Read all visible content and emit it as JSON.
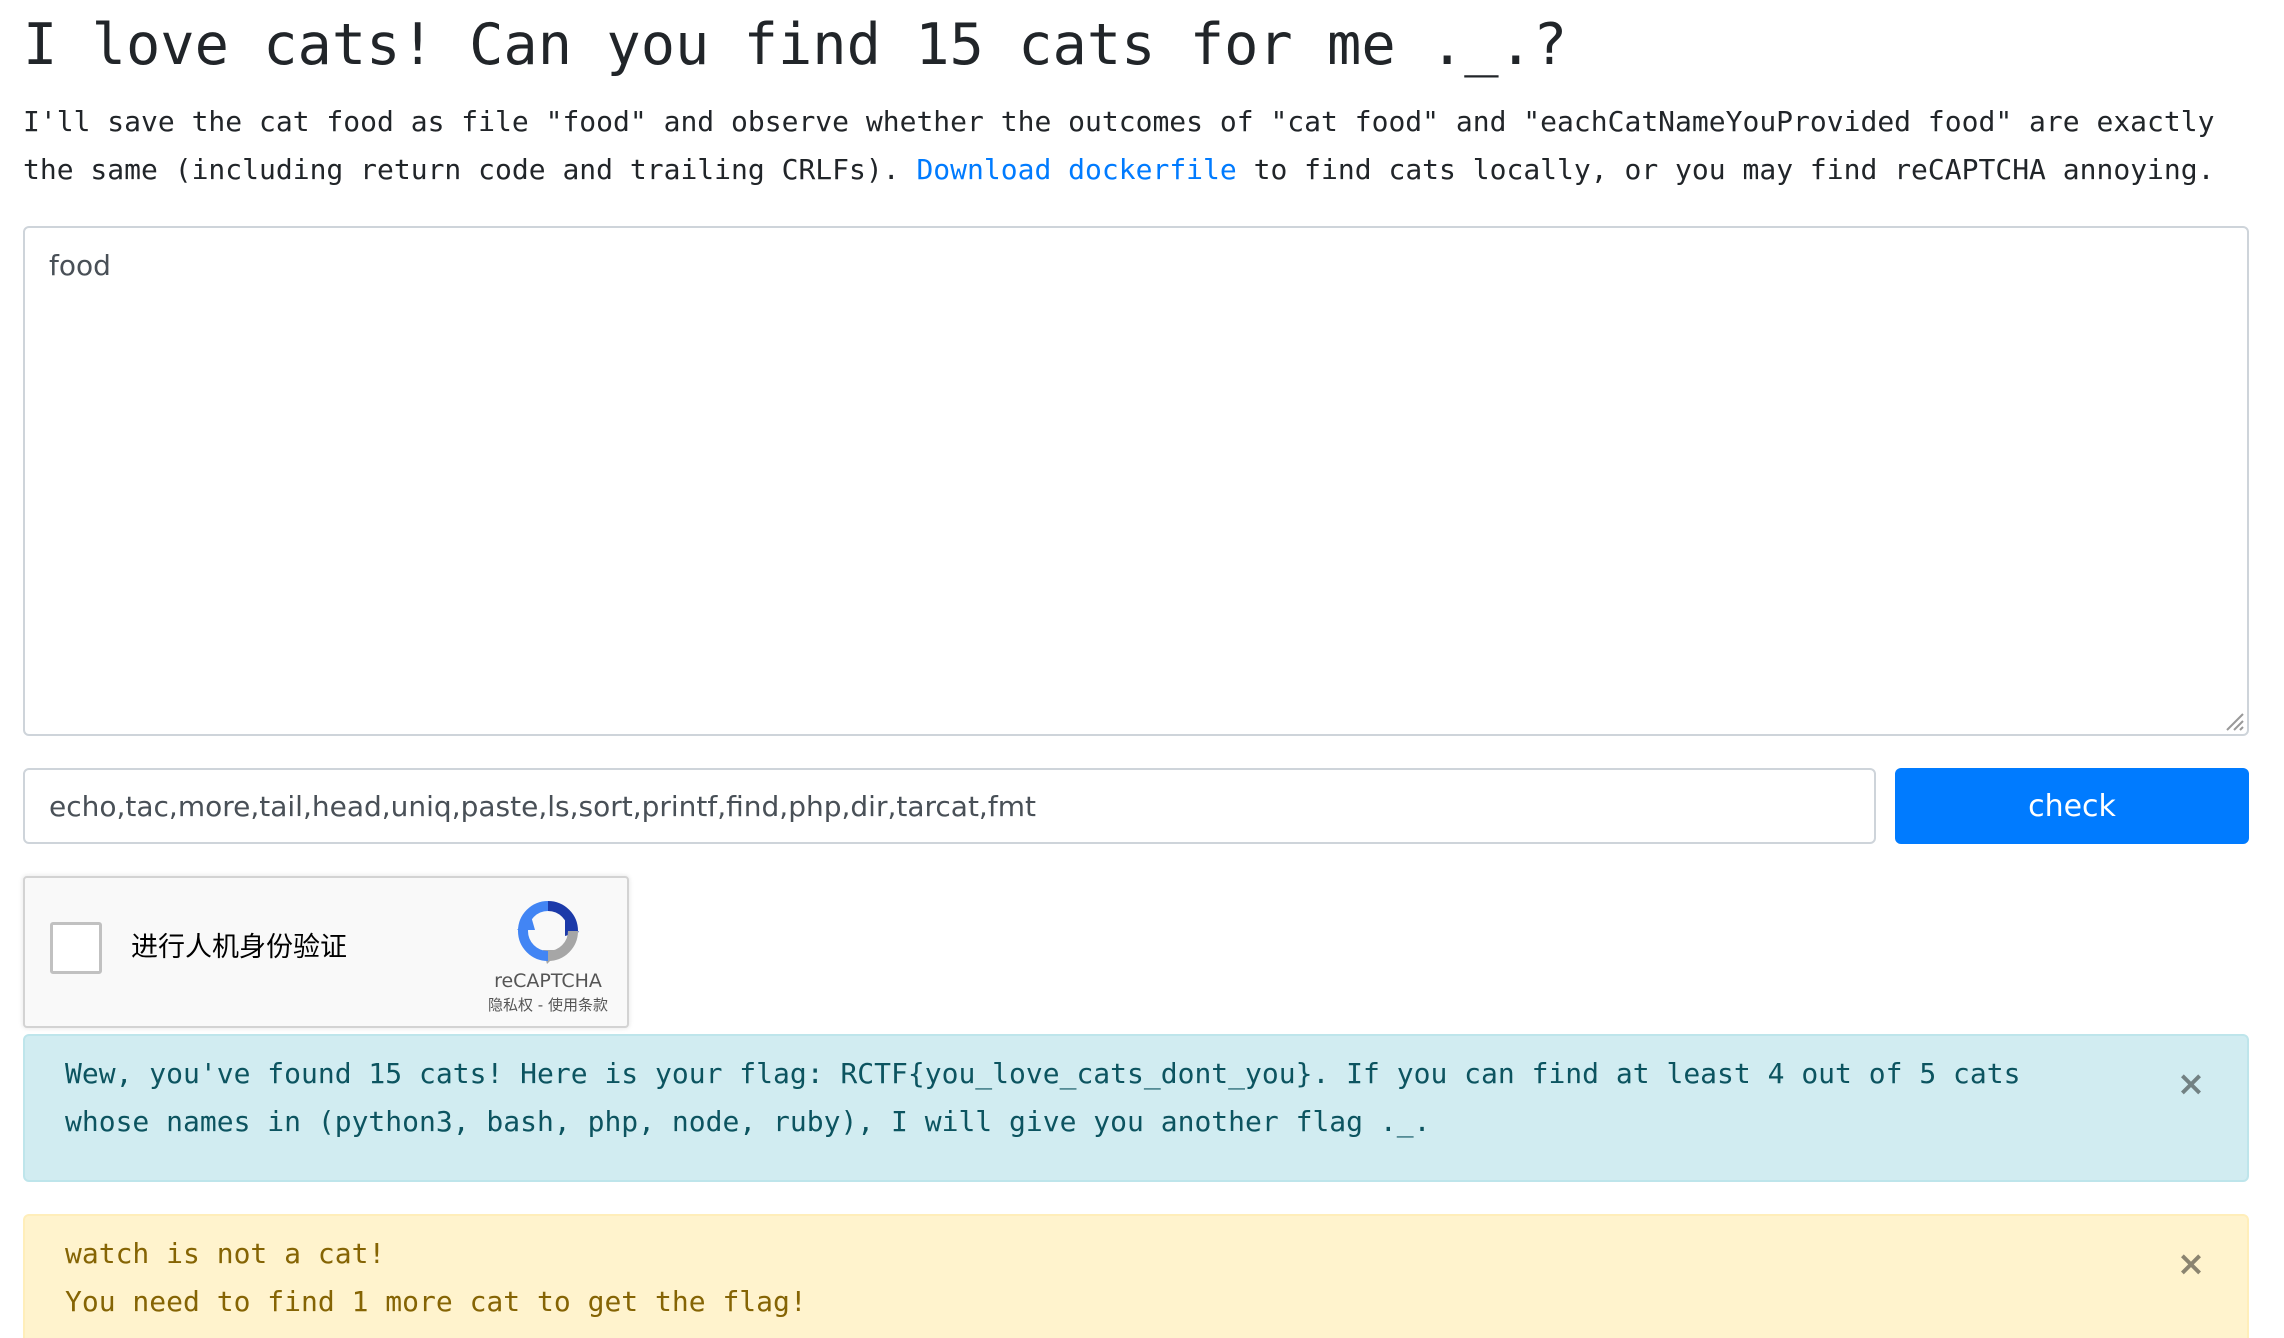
{
  "page": {
    "title": "I love cats! Can you find 15 cats for me ._.?",
    "intro_before_link": "I'll save the cat food as file \"food\" and observe whether the outcomes of \"cat food\" and \"eachCatNameYouProvided food\" are exactly the same (including return code and trailing CRLFs). ",
    "intro_link": "Download dockerfile",
    "intro_after_link": " to find cats locally, or you may find reCAPTCHA annoying."
  },
  "form": {
    "food_value": "food",
    "cats_value": "echo,tac,more,tail,head,uniq,paste,ls,sort,printf,find,php,dir,tarcat,fmt",
    "check_label": "check"
  },
  "recaptcha": {
    "label": "进行人机身份验证",
    "brand": "reCAPTCHA",
    "privacy": "隐私权",
    "separator": " - ",
    "terms": "使用条款"
  },
  "alerts": {
    "info": {
      "text": "Wew, you've found 15 cats! Here is your flag: RCTF{you_love_cats_dont_you}. If you can find at least 4 out of 5 cats whose names in (python3, bash, php, node, ruby), I will give you another flag ._.",
      "close": "×"
    },
    "warning": {
      "line1": "watch is not a cat!",
      "line2": "You need to find 1 more cat to get the flag!",
      "close": "×"
    }
  },
  "colors": {
    "primary": "#007bff",
    "info_bg": "#d1ecf1",
    "info_text": "#0c5460",
    "warning_bg": "#fff3cd",
    "warning_text": "#856404"
  },
  "icons": {
    "recaptcha_logo": "recaptcha-logo-icon",
    "close": "close-icon",
    "resize": "resize-grip-icon"
  }
}
